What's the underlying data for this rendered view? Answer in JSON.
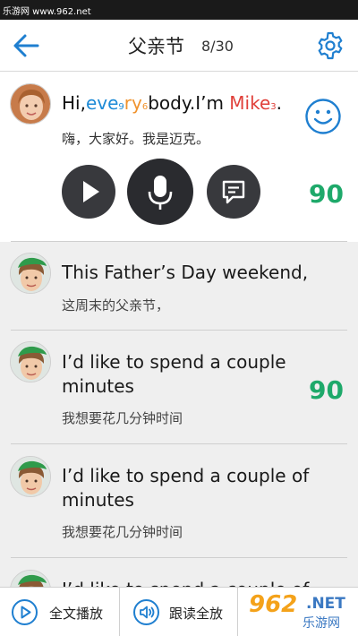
{
  "status_bar": {
    "watermark": "乐游网 www.962.net"
  },
  "header": {
    "title": "父亲节",
    "progress": "8/30",
    "back_icon": "arrow-left-icon",
    "settings_icon": "gear-icon"
  },
  "active_sentence": {
    "english_parts": [
      {
        "text": "Hi,",
        "color": "#111111"
      },
      {
        "text": "eve",
        "color": "#1d8ad6"
      },
      {
        "text": "9",
        "color": "#1d8ad6",
        "small": true
      },
      {
        "text": "ry",
        "color": "#f0932e"
      },
      {
        "text": "6",
        "color": "#f0932e",
        "small": true
      },
      {
        "text": "body.I’m ",
        "color": "#111111"
      },
      {
        "text": "Mike",
        "color": "#e0403a"
      },
      {
        "text": "3",
        "color": "#e0403a",
        "small": true
      },
      {
        "text": ".",
        "color": "#111111"
      }
    ],
    "chinese": "嗨，大家好。我是迈克。",
    "score": "90",
    "feedback_icon": "smiley-face-icon",
    "controls": {
      "play_icon": "play-icon",
      "mic_icon": "microphone-icon",
      "chat_icon": "chat-bubble-icon"
    }
  },
  "sentences": [
    {
      "english": "This Father’s Day weekend,",
      "chinese": "这周末的父亲节，",
      "score": ""
    },
    {
      "english": "I’d like to spend a couple minutes",
      "chinese": "我想要花几分钟时间",
      "score": "90"
    },
    {
      "english": "I’d like to spend a couple of minutes",
      "chinese": "我想要花几分钟时间",
      "score": ""
    },
    {
      "english": "I’d like to spend a couple of",
      "chinese": "",
      "score": ""
    }
  ],
  "bottom_bar": {
    "play_all_label": "全文播放",
    "read_all_label": "跟读全放",
    "logo_number": "962",
    "logo_net": ".NET",
    "logo_cn": "乐游网"
  },
  "colors": {
    "accent_blue": "#1f7fd0",
    "score_green": "#1ea96a",
    "control_dark": "#38393d"
  }
}
